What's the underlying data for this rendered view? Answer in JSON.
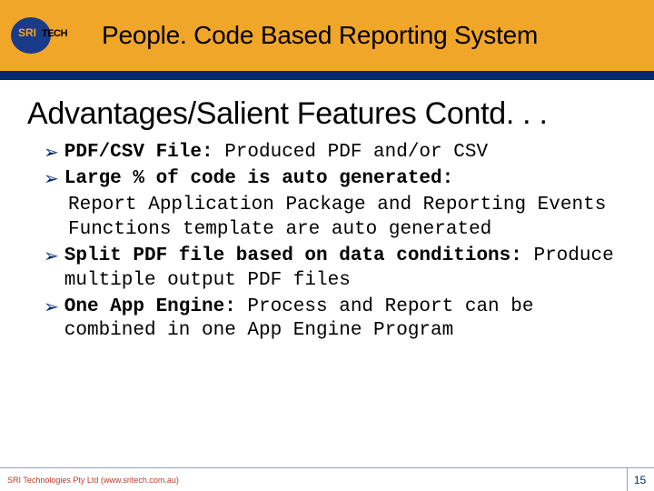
{
  "header": {
    "logo_sri": "SRI",
    "logo_tech": "TECH",
    "title": "People. Code Based Reporting System"
  },
  "section_heading": "Advantages/Salient Features Contd. . .",
  "bullets": [
    {
      "lead": "PDF/CSV File:",
      "rest": " Produced PDF and/or CSV"
    },
    {
      "lead": "Large % of code is auto generated:",
      "rest": ""
    }
  ],
  "sub1": "Report Application Package and Reporting Events Functions template are auto generated",
  "bullets2": [
    {
      "lead": "Split PDF file based on data conditions:",
      "rest": " Produce multiple output PDF files"
    },
    {
      "lead": "One App Engine:",
      "rest": " Process and Report can be combined in one App Engine Program"
    }
  ],
  "footer": {
    "left": "SRI Technologies Pty Ltd (www.sritech.com.au)",
    "page": "15"
  }
}
